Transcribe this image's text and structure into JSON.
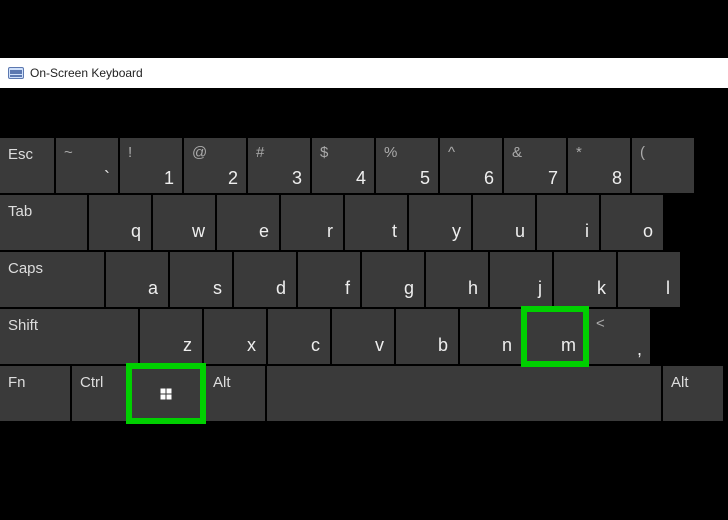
{
  "window": {
    "title": "On-Screen Keyboard"
  },
  "rows": {
    "fn": {
      "esc": {
        "label": "Esc"
      },
      "tilde": {
        "top": "~",
        "bottom": "`"
      },
      "k1": {
        "top": "!",
        "bottom": "1"
      },
      "k2": {
        "top": "@",
        "bottom": "2"
      },
      "k3": {
        "top": "#",
        "bottom": "3"
      },
      "k4": {
        "top": "$",
        "bottom": "4"
      },
      "k5": {
        "top": "%",
        "bottom": "5"
      },
      "k6": {
        "top": "^",
        "bottom": "6"
      },
      "k7": {
        "top": "&",
        "bottom": "7"
      },
      "k8": {
        "top": "*",
        "bottom": "8"
      },
      "k9": {
        "top": "(",
        "bottom": ""
      }
    },
    "qwerty": {
      "tab": {
        "label": "Tab"
      },
      "q": {
        "g": "q"
      },
      "w": {
        "g": "w"
      },
      "e": {
        "g": "e"
      },
      "r": {
        "g": "r"
      },
      "t": {
        "g": "t"
      },
      "y": {
        "g": "y"
      },
      "u": {
        "g": "u"
      },
      "i": {
        "g": "i"
      },
      "o": {
        "g": "o"
      }
    },
    "home": {
      "caps": {
        "label": "Caps"
      },
      "a": {
        "g": "a"
      },
      "s": {
        "g": "s"
      },
      "d": {
        "g": "d"
      },
      "f": {
        "g": "f"
      },
      "g": {
        "g": "g"
      },
      "h": {
        "g": "h"
      },
      "j": {
        "g": "j"
      },
      "k": {
        "g": "k"
      },
      "l": {
        "g": "l"
      }
    },
    "bottomletters": {
      "shift": {
        "label": "Shift"
      },
      "z": {
        "g": "z"
      },
      "x": {
        "g": "x"
      },
      "c": {
        "g": "c"
      },
      "v": {
        "g": "v"
      },
      "b": {
        "g": "b"
      },
      "n": {
        "g": "n"
      },
      "m": {
        "g": "m"
      },
      "comma": {
        "top": "<",
        "bottom": ","
      }
    },
    "mods": {
      "fn": {
        "label": "Fn"
      },
      "ctrl": {
        "label": "Ctrl"
      },
      "altL": {
        "label": "Alt"
      },
      "altR": {
        "label": "Alt"
      }
    }
  },
  "highlights": [
    "win-key",
    "m-key"
  ]
}
